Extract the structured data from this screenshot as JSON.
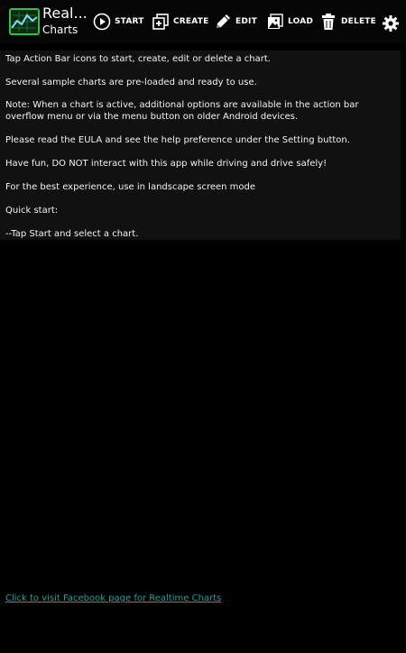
{
  "app": {
    "title_line1": "Real...",
    "title_line2": "Charts"
  },
  "actions": {
    "start": "START",
    "create": "CREATE",
    "edit": "EDIT",
    "load": "LOAD",
    "delete": "DELETE"
  },
  "icons": {
    "app_logo": "chart-logo-icon",
    "start": "play-circle-icon",
    "create": "add-chart-icon",
    "edit": "pencil-icon",
    "load": "image-load-icon",
    "delete": "trash-icon",
    "settings": "gear-icon"
  },
  "info": {
    "p1": "Tap Action Bar icons to start, create, edit or delete a chart.",
    "p2": "Several sample charts are pre-loaded and ready to use.",
    "p3": "Note: When a chart is active, additional options are available in the action bar overflow menu or via the menu button on older Android devices.",
    "p4": "Please read the EULA and see the help preference under the Setting button.",
    "p5": "Have fun, DO NOT interact with this app while driving and drive safely!",
    "p6": "For the best experience, use in landscape screen mode",
    "p7": "Quick start:",
    "p8": " --Tap Start and select a chart."
  },
  "footer": {
    "link_text": "Click to visit Facebook page for Realtime Charts"
  },
  "colors": {
    "background": "#000000",
    "panel": "#111111",
    "link": "#1aa3a3",
    "logo_green": "#2fbf4a"
  }
}
